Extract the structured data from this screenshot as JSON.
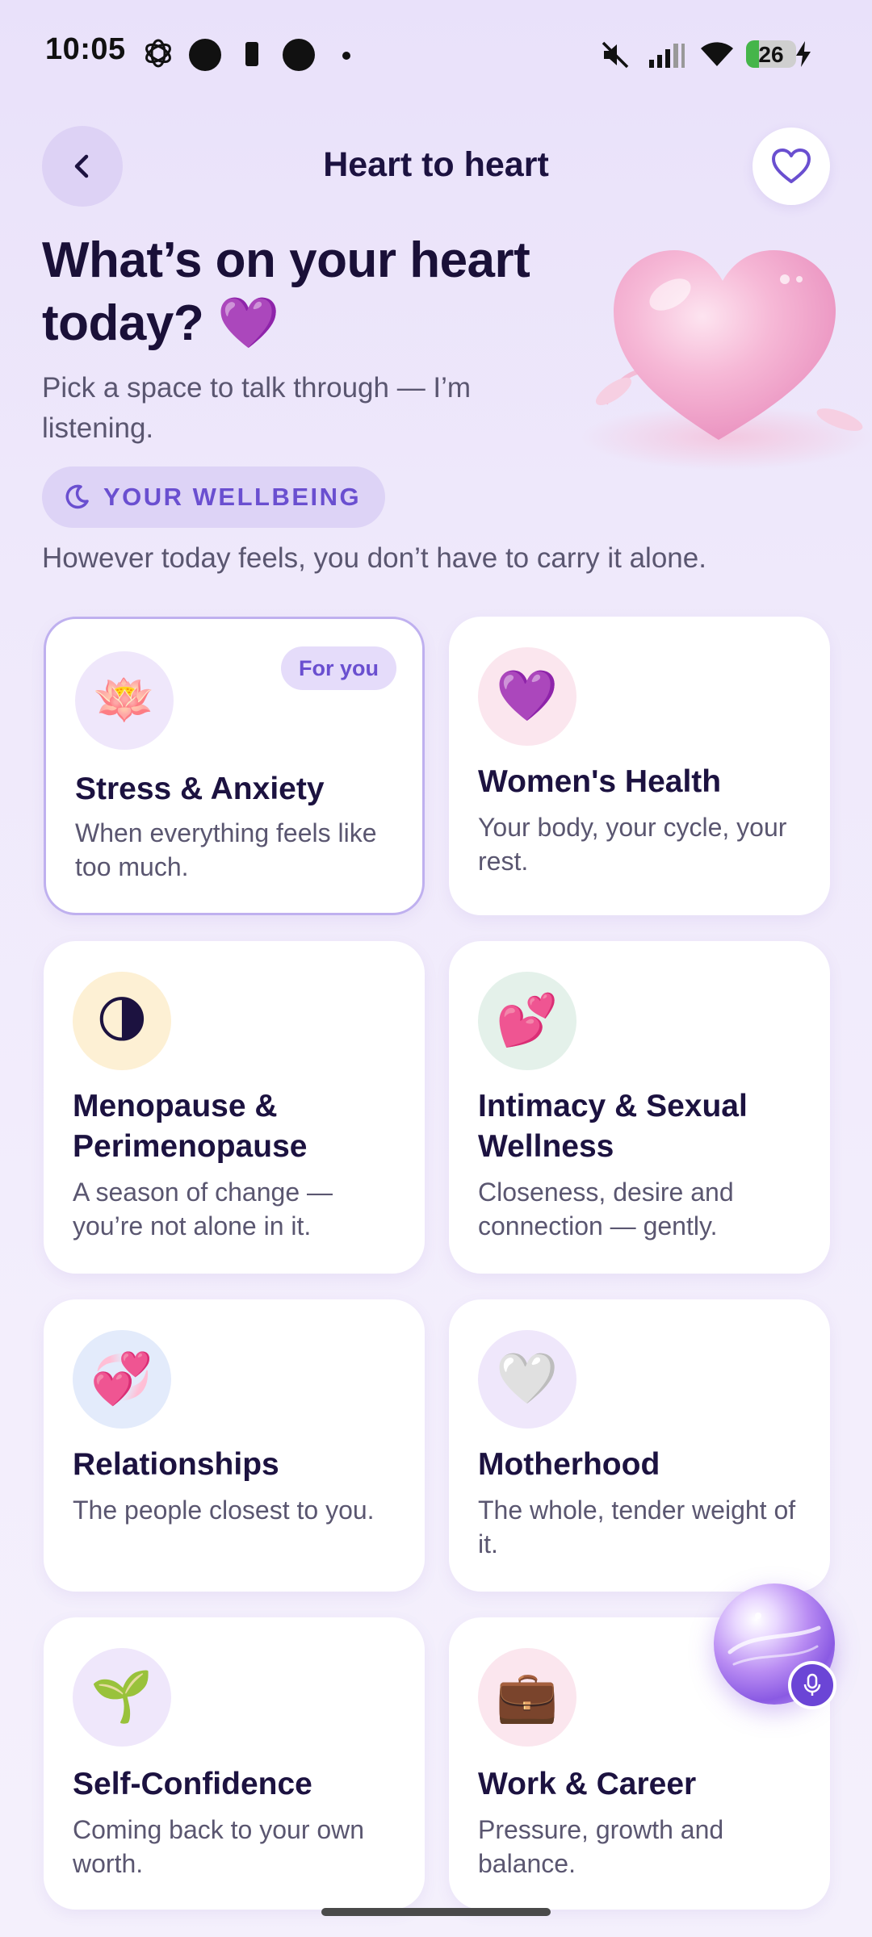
{
  "status_bar": {
    "time": "10:05",
    "battery_level": "26",
    "battery_fraction": 0.26,
    "icons": [
      "chatgpt-icon",
      "record-dot-icon",
      "battery-saver-icon",
      "record-dot-icon",
      "small-dot-icon",
      "mute-icon",
      "signal-icon",
      "wifi-icon",
      "charging-icon"
    ]
  },
  "header": {
    "title": "Heart to heart",
    "back_icon": "chevron-left-icon",
    "favorite_icon": "heart-outline-icon"
  },
  "hero": {
    "heading_line1": "What’s on your heart",
    "heading_line2": "today?",
    "heading_emoji": "💜",
    "subtitle": "Pick a space to talk through — I’m listening.",
    "illustration": "pink-heart-illustration"
  },
  "chip": {
    "icon": "moon-icon",
    "label": "YOUR WELLBEING"
  },
  "tagline": "However today feels, you don’t have to carry it alone.",
  "cards": [
    {
      "emoji": "🪷",
      "icon_name": "lotus-icon",
      "title": "Stress & Anxiety",
      "desc": "When everything feels like too much.",
      "badge": "For you",
      "icon_bg": "#efe7fb"
    },
    {
      "emoji": "💜",
      "icon_name": "purple-heart-icon",
      "title": "Women's Health",
      "desc": "Your body, your cycle, your rest.",
      "icon_bg": "#fbe6ee"
    },
    {
      "emoji": "🌗",
      "icon_name": "half-moon-icon",
      "title": "Menopause & Perimenopause",
      "desc": "A season of change — you’re not alone in it.",
      "icon_bg": "#fdf0d4"
    },
    {
      "emoji": "💕",
      "icon_name": "two-hearts-icon",
      "title": "Intimacy & Sexual Wellness",
      "desc": "Closeness, desire and connection — gently.",
      "icon_bg": "#e4f1ea"
    },
    {
      "emoji": "💞",
      "icon_name": "revolving-hearts-icon",
      "title": "Relationships",
      "desc": "The people closest to you.",
      "icon_bg": "#e3ebfb"
    },
    {
      "emoji": "🤍",
      "icon_name": "white-heart-icon",
      "title": "Motherhood",
      "desc": "The whole, tender weight of it.",
      "icon_bg": "#efe7fb"
    },
    {
      "emoji": "🌱",
      "icon_name": "seedling-icon",
      "title": "Self-Confidence",
      "desc": "Coming back to your own worth.",
      "icon_bg": "#efe7fb"
    },
    {
      "emoji": "💼",
      "icon_name": "briefcase-icon",
      "title": "Work & Career",
      "desc": "Pressure, growth and balance.",
      "icon_bg": "#fbe6ee"
    }
  ],
  "floating": {
    "orb_icon": "assistant-orb-icon",
    "mic_icon": "microphone-icon"
  },
  "colors": {
    "accent": "#6a4fd0",
    "title": "#1c1240",
    "muted": "#5a5670",
    "background": "#efe9fb"
  }
}
